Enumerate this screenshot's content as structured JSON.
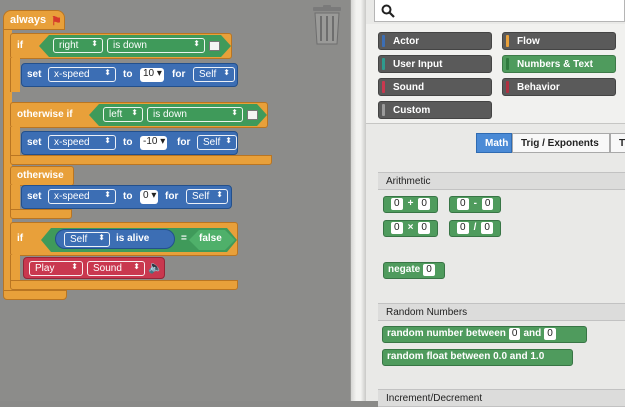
{
  "script": {
    "hat_label": "always",
    "if1": {
      "keyword": "if",
      "key": "right",
      "state": "is down",
      "set_label": "set",
      "prop": "x-speed",
      "to_label": "to",
      "value": "10",
      "for_label": "for",
      "target": "Self"
    },
    "if2": {
      "keyword": "otherwise if",
      "key": "left",
      "state": "is down",
      "set_label": "set",
      "prop": "x-speed",
      "to_label": "to",
      "value": "-10",
      "for_label": "for",
      "target": "Self"
    },
    "otherwise": {
      "keyword": "otherwise",
      "set_label": "set",
      "prop": "x-speed",
      "to_label": "to",
      "value": "0",
      "for_label": "for",
      "target": "Self"
    },
    "if3": {
      "keyword": "if",
      "subject": "Self",
      "alive_label": "is alive",
      "eq": "=",
      "value": "false",
      "play_label": "Play",
      "sound_label": "Sound"
    }
  },
  "palette": {
    "categories": [
      {
        "label": "Actor",
        "stripe": "#3c6eb4"
      },
      {
        "label": "Flow",
        "stripe": "#e8a03a"
      },
      {
        "label": "User Input",
        "stripe": "#2e9b8e"
      },
      {
        "label": "Numbers & Text",
        "stripe": "#4f9b5d",
        "selected": true
      },
      {
        "label": "Sound",
        "stripe": "#c9384f"
      },
      {
        "label": "Behavior",
        "stripe": "#b03040"
      },
      {
        "label": "Custom",
        "stripe": "#9a9a9a"
      }
    ],
    "tabs": [
      "Math",
      "Trig / Exponents",
      "T"
    ],
    "active_tab": "Math",
    "sections": {
      "arithmetic": "Arithmetic",
      "random": "Random Numbers",
      "increment": "Increment/Decrement"
    },
    "arith": {
      "zero": "0",
      "plus": "+",
      "minus": "-",
      "times": "×",
      "divide": "/",
      "negate_label": "negate"
    },
    "random_number_label": "random number between",
    "and_label": "and",
    "random_float_label": "random float between 0.0 and 1.0"
  },
  "colors": {
    "flow": "#e8a03a",
    "actor": "#3c6eb4",
    "numbers": "#4f9b5d",
    "sound": "#c9384f",
    "active_tab": "#4a8ad6"
  },
  "icons": [
    "flag-icon",
    "trash-icon",
    "search-icon",
    "speaker-icon",
    "chevron-updown-icon"
  ]
}
